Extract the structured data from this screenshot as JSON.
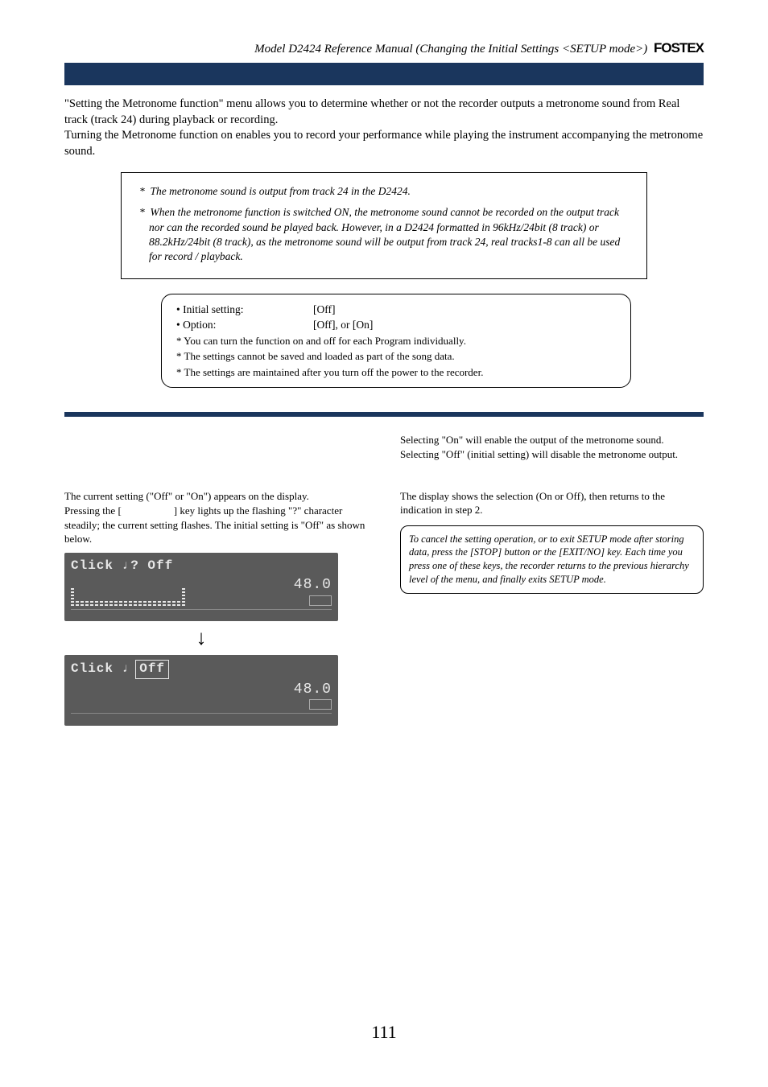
{
  "header": {
    "breadcrumb": "Model D2424 Reference Manual (Changing the Initial Settings <SETUP mode>)",
    "brand": "FOSTEX"
  },
  "intro": {
    "p1": "\"Setting the Metronome function\" menu allows you to determine whether or not the recorder outputs a metronome sound from Real track (track 24) during playback or recording.",
    "p2": "Turning the Metronome function on enables you to record your performance while playing the instrument accompanying the metronome sound."
  },
  "note_box": {
    "item1": "The metronome sound is output from track 24 in the D2424.",
    "item2": "When the metronome function is switched ON, the metronome sound cannot be recorded on the output track nor can the recorded sound be played back.  However, in a D2424 formatted in 96kHz/24bit (8 track) or 88.2kHz/24bit (8 track), as the metronome sound will be output from track 24, real tracks1-8 can all be used for record / playback."
  },
  "settings_box": {
    "initial_label": "• Initial setting:",
    "initial_value": "[Off]",
    "option_label": "• Option:",
    "option_value": "[Off], or [On]",
    "n1": "* You can turn the function on and off for each Program individually.",
    "n2": "* The settings cannot be saved and loaded as part of the song data.",
    "n3": "* The settings are maintained after you turn off the power to the recorder."
  },
  "left": {
    "p1a": "The current setting (\"Off\" or \"On\") appears on the display.",
    "p1b_pre": "Pressing the [",
    "p1b_post": "] key lights up the flashing \"?\" character steadily; the current setting flashes. The initial setting is \"Off\" as shown below.",
    "lcd1_text": "Click ♩? Off",
    "lcd2_text_pre": "Click ♩ ",
    "lcd2_text_boxed": "Off",
    "rate": "48.0"
  },
  "right": {
    "p1": "Selecting \"On\" will enable the output of the metronome sound.  Selecting \"Off\" (initial setting) will disable the metronome output.",
    "p2": "The display shows the selection (On or Off), then returns to the indication in step 2.",
    "note": "To cancel the setting operation, or to exit SETUP mode after storing data, press the [STOP] button or the [EXIT/NO] key.  Each time you press one of these keys, the recorder returns to the previous hierarchy level of the menu, and finally exits SETUP mode."
  },
  "page_number": "111"
}
